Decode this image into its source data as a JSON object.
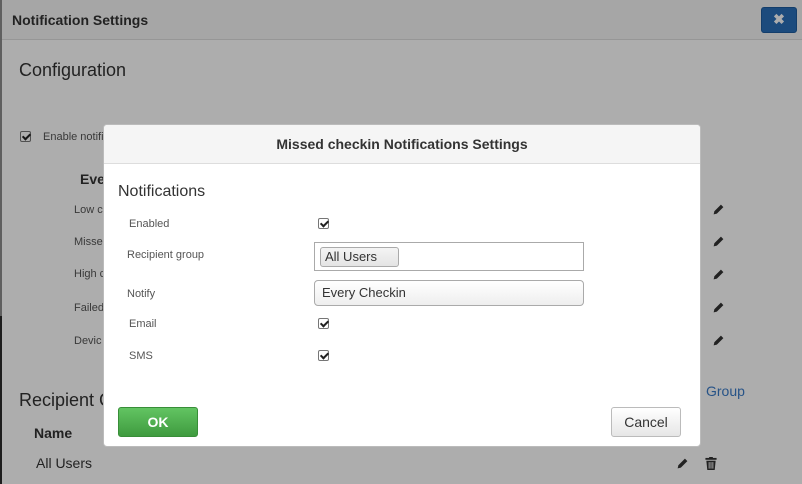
{
  "outer": {
    "title": "Notification Settings",
    "close_label": "✖",
    "configuration_title": "Configuration",
    "enable_label_partial": "Enable notifi",
    "events_header_partial": "Eve",
    "event_rows": [
      {
        "label_partial": "Low c"
      },
      {
        "label_partial": "Misse"
      },
      {
        "label_partial": "High c"
      },
      {
        "label_partial": "Failed"
      },
      {
        "label_partial": "Devic"
      }
    ],
    "recipient_title_partial": "Recipient G",
    "add_group_link_partial": "Group",
    "recipient_table": {
      "header_name": "Name",
      "rows": [
        {
          "name": "All Users"
        }
      ]
    }
  },
  "modal": {
    "title": "Missed checkin Notifications Settings",
    "section": "Notifications",
    "fields": {
      "enabled": {
        "label": "Enabled",
        "checked": true
      },
      "recipient_group": {
        "label": "Recipient group",
        "value": "All Users"
      },
      "notify": {
        "label": "Notify",
        "value": "Every Checkin"
      },
      "email": {
        "label": "Email",
        "checked": true
      },
      "sms": {
        "label": "SMS",
        "checked": true
      }
    },
    "ok_label": "OK",
    "cancel_label": "Cancel"
  },
  "colors": {
    "primary": "#2a6fb9",
    "success": "#4cae4c",
    "link": "#3a7bc8"
  }
}
